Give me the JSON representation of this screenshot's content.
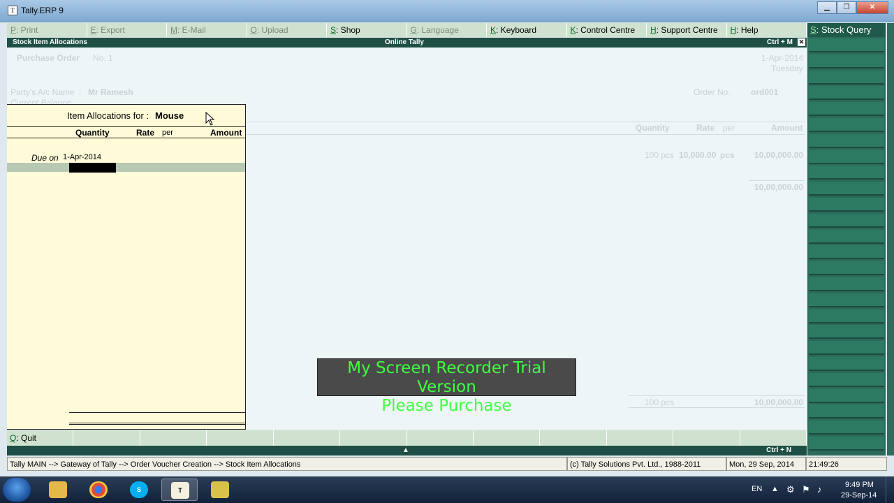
{
  "window": {
    "title": "Tally.ERP 9",
    "app_icon_text": "T"
  },
  "top_menu": [
    {
      "key": "P",
      "label": ": Print",
      "enabled": false
    },
    {
      "key": "E",
      "label": ": Export",
      "enabled": false
    },
    {
      "key": "M",
      "label": ": E-Mail",
      "enabled": false
    },
    {
      "key": "O",
      "label": ": Upload",
      "enabled": false
    },
    {
      "key": "S",
      "label": ": Shop",
      "enabled": true
    },
    {
      "key": "G",
      "label": ": Language",
      "enabled": false
    },
    {
      "key": "K",
      "label": ": Keyboard",
      "enabled": true
    },
    {
      "key": "K",
      "label": ": Control Centre",
      "enabled": true
    },
    {
      "key": "H",
      "label": ": Support Centre",
      "enabled": true
    },
    {
      "key": "H",
      "label": ": Help",
      "enabled": true
    }
  ],
  "header": {
    "left": "Stock Item Allocations",
    "center": "Online Tally",
    "right": "Ctrl + M",
    "close": "✕"
  },
  "voucher": {
    "type": "Purchase Order",
    "number_label": "No.",
    "number": "1",
    "date": "1-Apr-2014",
    "day": "Tuesday",
    "party_label": "Party's A/c Name",
    "party": "Mr Ramesh",
    "balance_label": "Current Balance",
    "order_no_label": "Order No.",
    "order_no": "ord001",
    "col_quantity": "Quantity",
    "col_rate": "Rate",
    "col_per": "per",
    "col_amount": "Amount",
    "line_qty": "100 pcs",
    "line_rate": "10,000.00",
    "line_per": "pcs",
    "line_amount": "10,00,000.00",
    "subtotal": "10,00,000.00",
    "total_qty": "100 pcs",
    "total_amount": "10,00,000.00"
  },
  "popup": {
    "title_label": "Item Allocations for :",
    "item_name": "Mouse",
    "col_quantity": "Quantity",
    "col_rate": "Rate",
    "col_per": "per",
    "col_amount": "Amount",
    "due_label": "Due on",
    "due_date": "1-Apr-2014"
  },
  "watermark": {
    "line1": "My Screen Recorder Trial Version",
    "line2": "Please Purchase"
  },
  "bottom_bar": {
    "quit_key": "Q",
    "quit_label": ": Quit",
    "ctrl_up": "▲",
    "ctrl_n": "Ctrl + N"
  },
  "status": {
    "breadcrumb": "Tally MAIN --> Gateway of Tally --> Order Voucher  Creation  --> Stock Item Allocations",
    "copyright": "(c) Tally Solutions Pvt. Ltd., 1988-2011",
    "date": "Mon, 29 Sep, 2014",
    "time": "21:49:26"
  },
  "right_panel": {
    "key": "S",
    "label": ": Stock Query"
  },
  "taskbar": {
    "lang": "EN",
    "clock_time": "9:49 PM",
    "clock_date": "29-Sep-14",
    "apps": [
      "explorer-icon",
      "chrome-icon",
      "skype-icon",
      "tally-icon",
      "recorder-icon"
    ]
  }
}
